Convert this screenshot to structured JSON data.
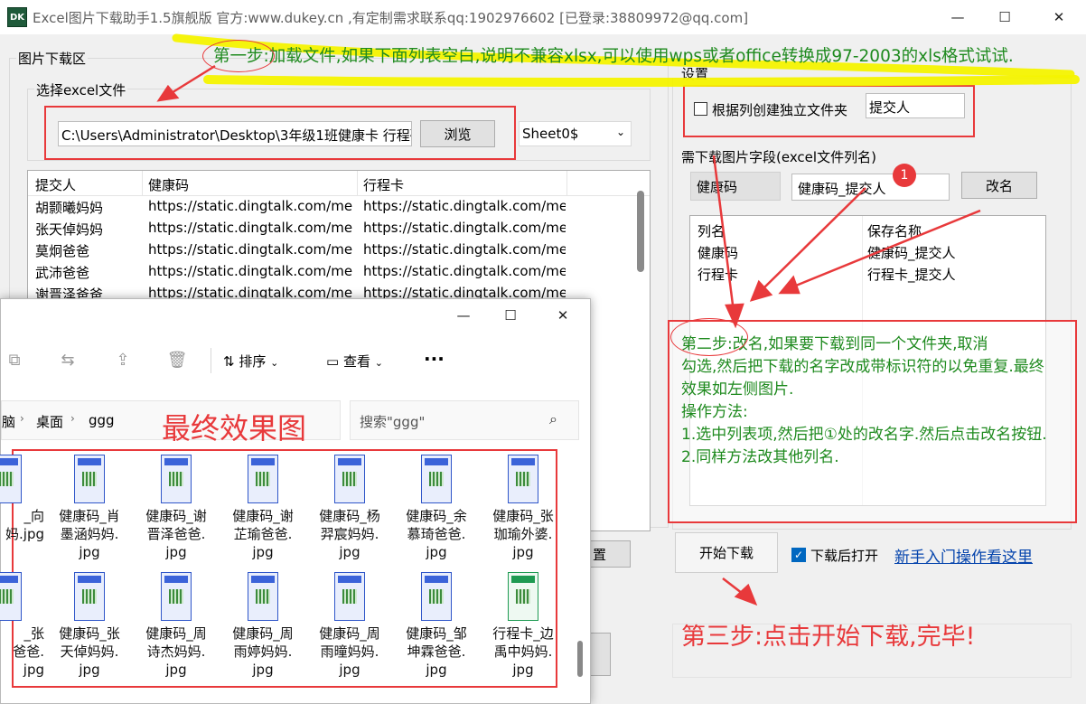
{
  "window": {
    "title": "Excel图片下载助手1.5旗舰版 官方:www.dukey.cn ,有定制需求联系qq:1902976602  [已登录:38809972@qq.com]",
    "icon_text": "DK",
    "minimize": "—",
    "maximize": "☐",
    "close": "✕"
  },
  "download_area": {
    "label": "图片下载区",
    "select_file_label": "选择excel文件",
    "file_path": "C:\\Users\\Administrator\\Desktop\\3年级1班健康卡 行程码.xlsx",
    "browse_label": "浏览",
    "sheet_value": "Sheet0$",
    "table": {
      "headers": [
        "提交人",
        "健康码",
        "行程卡"
      ],
      "rows": [
        [
          "胡颢曦妈妈",
          "https://static.dingtalk.com/medi...",
          "https://static.dingtalk.com/med..."
        ],
        [
          "张天倬妈妈",
          "https://static.dingtalk.com/medi...",
          "https://static.dingtalk.com/med..."
        ],
        [
          "莫炯爸爸",
          "https://static.dingtalk.com/medi...",
          "https://static.dingtalk.com/med..."
        ],
        [
          "武沛爸爸",
          "https://static.dingtalk.com/medi...",
          "https://static.dingtalk.com/med..."
        ],
        [
          "谢晋泽爸爸",
          "https://static.dingtalk.com/medi...",
          "https://static.dingtalk.com/med..."
        ]
      ]
    },
    "hidden_button_partial": "置"
  },
  "settings": {
    "label": "设置",
    "checkbox_label": "根据列创建独立文件夹",
    "folder_column": "提交人",
    "fields_label": "需下载图片字段(excel文件列名)",
    "field_name": "健康码",
    "rename_value": "健康码_提交人",
    "rename_label": "改名",
    "badge": "1",
    "list_headers": [
      "列名",
      "保存名称"
    ],
    "list_rows": [
      [
        "健康码",
        "健康码_提交人"
      ],
      [
        "行程卡",
        "行程卡_提交人"
      ]
    ],
    "start_label": "开始下载",
    "open_after_label": "下载后打开",
    "tutorial_link": "新手入门操作看这里"
  },
  "annotations": {
    "step1": "第一步:加载文件,如果下面列表空白,说明不兼容xlsx,可以使用wps或者office转换成97-2003的xls格式试试.",
    "step2": "第二步:改名,如果要下载到同一个文件夹,取消\n勾选,然后把下载的名字改成带标识符的以免重复.最终\n效果如左侧图片.\n操作方法:\n1.选中列表项,然后把①处的改名字.然后点击改名按钮.\n2.同样方法改其他列名.",
    "step3": "第三步:点击开始下载,完毕!",
    "final_result": "最终效果图"
  },
  "explorer": {
    "minimize": "—",
    "maximize": "☐",
    "close": "✕",
    "sort_label": "排序",
    "view_label": "查看",
    "more": "···",
    "breadcrumb": [
      "脑",
      "桌面",
      "ggg"
    ],
    "search_placeholder": "搜索\"ggg\"",
    "files": [
      [
        "_向",
        "妈.jpg"
      ],
      [
        "健康码_肖",
        "墨涵妈妈.",
        "jpg"
      ],
      [
        "健康码_谢",
        "晋泽爸爸.",
        "jpg"
      ],
      [
        "健康码_谢",
        "芷瑜爸爸.",
        "jpg"
      ],
      [
        "健康码_杨",
        "羿宸妈妈.",
        "jpg"
      ],
      [
        "健康码_余",
        "慕琦爸爸.",
        "jpg"
      ],
      [
        "健康码_张",
        "珈瑜外婆.",
        "jpg"
      ],
      [
        "_张",
        "爸爸.",
        "jpg"
      ],
      [
        "健康码_张",
        "天倬妈妈.",
        "jpg"
      ],
      [
        "健康码_周",
        "诗杰妈妈.",
        "jpg"
      ],
      [
        "健康码_周",
        "雨婷妈妈.",
        "jpg"
      ],
      [
        "健康码_周",
        "雨曈妈妈.",
        "jpg"
      ],
      [
        "健康码_邹",
        "坤霖爸爸.",
        "jpg"
      ],
      [
        "行程卡_边",
        "禹中妈妈.",
        "jpg"
      ]
    ]
  },
  "colors": {
    "annotation_red": "#e8393b",
    "annotation_green": "#1e8a1e",
    "highlight_yellow": "#f4f300",
    "link_blue": "#0645ad"
  }
}
